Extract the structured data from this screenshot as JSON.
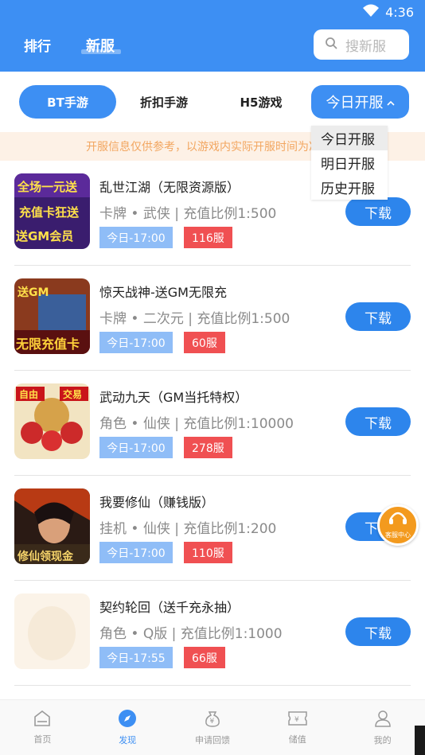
{
  "status": {
    "time": "4:36"
  },
  "header": {
    "tabs": [
      {
        "label": "排行"
      },
      {
        "label": "新服"
      }
    ],
    "search_placeholder": "搜新服"
  },
  "filters": {
    "tabs": [
      {
        "label": "BT手游"
      },
      {
        "label": "折扣手游"
      },
      {
        "label": "H5游戏"
      }
    ],
    "day_select": {
      "label": "今日开服"
    },
    "dropdown": [
      {
        "label": "今日开服"
      },
      {
        "label": "明日开服"
      },
      {
        "label": "历史开服"
      }
    ]
  },
  "notice": "开服信息仅供参考，以游戏内实际开服时间为准",
  "games": [
    {
      "name": "乱世江湖（无限资源版）",
      "meta": "卡牌 • 武侠 | 充值比例1:500",
      "time": "今日-17:00",
      "server": "116服",
      "download": "下载",
      "thumb_text": [
        "全场一元送",
        "充值卡狂送",
        "送GM会员"
      ]
    },
    {
      "name": "惊天战神-送GM无限充",
      "meta": "卡牌 • 二次元 | 充值比例1:500",
      "time": "今日-17:00",
      "server": "60服",
      "download": "下载",
      "thumb_text": [
        "送GM",
        "无限充值卡"
      ]
    },
    {
      "name": "武动九天（GM当托特权）",
      "meta": "角色 • 仙侠 | 充值比例1:10000",
      "time": "今日-17:00",
      "server": "278服",
      "download": "下载",
      "thumb_text": [
        "自由",
        "交易"
      ]
    },
    {
      "name": "我要修仙（赚钱版）",
      "meta": "挂机 • 仙侠 | 充值比例1:200",
      "time": "今日-17:00",
      "server": "110服",
      "download": "下载",
      "thumb_text": [
        "修仙领现金"
      ]
    },
    {
      "name": "契约轮回（送千充永抽）",
      "meta": "角色 • Q版 | 充值比例1:1000",
      "time": "今日-17:55",
      "server": "66服",
      "download": "下载",
      "thumb_text": []
    }
  ],
  "float_help": {
    "label": "客服中心"
  },
  "bottom_nav": [
    {
      "label": "首页",
      "icon": "home-icon"
    },
    {
      "label": "发现",
      "icon": "compass-icon",
      "active": true
    },
    {
      "label": "申请回馈",
      "icon": "money-bag-icon"
    },
    {
      "label": "储值",
      "icon": "ticket-icon"
    },
    {
      "label": "我的",
      "icon": "user-icon"
    }
  ],
  "colors": {
    "primary": "#3d8ff3",
    "server_tag": "#f05052",
    "time_tag": "#8fbdf7",
    "notice_text": "#f2a660"
  }
}
